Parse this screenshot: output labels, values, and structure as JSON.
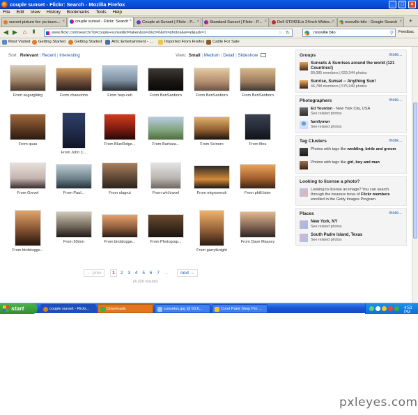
{
  "window": {
    "title": "couple sunset - Flickr: Search - Mozilla Firefox"
  },
  "menu": [
    "File",
    "Edit",
    "View",
    "History",
    "Bookmarks",
    "Tools",
    "Help"
  ],
  "tabs": [
    {
      "label": "sunset pixture for: ps tourn...",
      "color": "#e07a2d"
    },
    {
      "label": "couple sunset - Flickr: Search",
      "color": "#ff0084"
    },
    {
      "label": "Couple at Sunset | Flickr - P...",
      "color": "#ff0084"
    },
    {
      "label": "Standard Sunset | Flickr - P...",
      "color": "#ff0084"
    },
    {
      "label": "Dell ST2421Lb 24inch Wides...",
      "color": "#c22c2c"
    },
    {
      "label": "rossville bilo - Google Search",
      "color": "#3b73e0"
    }
  ],
  "address": {
    "url": "www.flickr.com/search/?q=couple+sunset&d=taken&ss=2&ct=0&mt=photos&w=all&adv=1"
  },
  "search": {
    "value": "rossville bilo"
  },
  "bookmarks": [
    "Most Visited",
    "Getting Started",
    "Getting Started",
    "Artic Entertainment - ...",
    "Imported From Firefox",
    "Cattle For Sale"
  ],
  "sort": {
    "label": "Sort:",
    "options": [
      "Relevant",
      "Recent",
      "Interesting"
    ]
  },
  "view": {
    "label": "View:",
    "options": [
      "Small",
      "Medium",
      "Detail",
      "Slideshow"
    ]
  },
  "photos": [
    {
      "caption": "From sugarglidrg",
      "colors": [
        "#d8cbb5",
        "#9e8366",
        "#4b3a2e"
      ]
    },
    {
      "caption": "From chasuinho",
      "colors": [
        "#d9a05a",
        "#6b4a38",
        "#2a1f1c"
      ]
    },
    {
      "caption": "From hwp-ceti",
      "colors": [
        "#b9c9d9",
        "#7d8fa1",
        "#2b2d33"
      ]
    },
    {
      "caption": "From BenSanborn",
      "colors": [
        "#3e3a36",
        "#191613",
        "#0a0908"
      ]
    },
    {
      "caption": "From BenSanborn",
      "colors": [
        "#e4c9a1",
        "#b48e6f",
        "#6a5447"
      ]
    },
    {
      "caption": "From BenSanborn",
      "colors": [
        "#d7b786",
        "#9b7c60",
        "#3e3832"
      ]
    },
    {
      "caption": "From quas",
      "colors": [
        "#a3683c",
        "#5a3822",
        "#2b1a10"
      ]
    },
    {
      "caption": "From John C...",
      "colors": [
        "#304066",
        "#1e2947",
        "#111425"
      ]
    },
    {
      "caption": "From BlueRidge...",
      "colors": [
        "#d23c1c",
        "#7a1a10",
        "#230806"
      ]
    },
    {
      "caption": "From Barbara...",
      "colors": [
        "#b7cbe0",
        "#7fa27a",
        "#4f6d3f"
      ]
    },
    {
      "caption": "From Scinern",
      "colors": [
        "#e0b36a",
        "#8a5a2f",
        "#1a140f"
      ]
    },
    {
      "caption": "From filnu",
      "colors": [
        "#3c4352",
        "#222733",
        "#101218"
      ]
    },
    {
      "caption": "From Grevel",
      "colors": [
        "#e8dfd8",
        "#c4b4b0",
        "#3a2c2e"
      ]
    },
    {
      "caption": "From Paul...",
      "colors": [
        "#bccbd3",
        "#6c8089",
        "#233139"
      ]
    },
    {
      "caption": "From olagrut",
      "colors": [
        "#a97e5c",
        "#5c4635",
        "#2d2219"
      ]
    },
    {
      "caption": "From whl.travel",
      "colors": [
        "#e3e4e6",
        "#b8b4b0",
        "#6f6660"
      ]
    },
    {
      "caption": "From mtgroveruk",
      "colors": [
        "#2f2a29",
        "#d48a37",
        "#1b1715"
      ]
    },
    {
      "caption": "From phill.lister",
      "colors": [
        "#e7a55b",
        "#a15d2c",
        "#3a2417"
      ]
    },
    {
      "caption": "From birdslogge...",
      "colors": [
        "#e3a66a",
        "#7a4a2c",
        "#231510"
      ]
    },
    {
      "caption": "From 50mm",
      "colors": [
        "#cfc7b6",
        "#6e6458",
        "#201c17"
      ]
    },
    {
      "caption": "From birdslogge...",
      "colors": [
        "#e8a36a",
        "#8a5a3d",
        "#2a1b14"
      ]
    },
    {
      "caption": "From Photograp...",
      "colors": [
        "#6a4b2f",
        "#3a2a1b",
        "#1a140d"
      ]
    },
    {
      "caption": "From garrytknight",
      "colors": [
        "#f2b36b",
        "#8b5a34",
        "#2b1b10"
      ]
    },
    {
      "caption": "From Dave Massey",
      "colors": [
        "#e1b88e",
        "#7d6152",
        "#2e2522"
      ]
    }
  ],
  "pager": {
    "prev": "← prev",
    "pages": [
      "1",
      "2",
      "3",
      "4",
      "5",
      "6",
      "7"
    ],
    "ellipsis": "...",
    "next": "next →",
    "results": "(4,320 results)"
  },
  "sidebar": {
    "groups": {
      "title": "Groups",
      "more": "more...",
      "items": [
        {
          "name": "Sunsets & Sunrises around the world (121 Countries!)",
          "meta": "89,085 members | 629,344 photos"
        },
        {
          "name": "Sunrise, Sunset -- Anything Sun!",
          "meta": "46,788 members | 575,949 photos"
        }
      ]
    },
    "photographers": {
      "title": "Photographers",
      "more": "more...",
      "items": [
        {
          "name": "Ed Yourdon",
          "loc": " - New York City, USA",
          "meta": "See related photos"
        },
        {
          "name": "familymwr",
          "loc": "",
          "meta": "See related photos"
        }
      ]
    },
    "tags": {
      "title": "Tag Clusters",
      "more": "more...",
      "items": [
        {
          "pre": "Photos with tags like ",
          "tags": "wedding, bride and groom"
        },
        {
          "pre": "Photos with tags like ",
          "tags": "girl, boy and man"
        }
      ]
    },
    "license": {
      "title": "Looking to license a photo?",
      "text1": "Looking to license an image? You can search through the treasure trove of ",
      "bold": "Flickr members",
      "text2": " enrolled in the Getty Images Program."
    },
    "places": {
      "title": "Places",
      "more": "more...",
      "items": [
        {
          "name": "New York, NY",
          "meta": "See related photos"
        },
        {
          "name": "South Padre Island, Texas",
          "meta": "See related photos"
        }
      ]
    }
  },
  "taskbar": {
    "start": "start",
    "buttons": [
      "couple sunset - Flickr...",
      "Downloads",
      "sunsetss.jpg @ 63.6...",
      "Corel Paint Shop Pro ..."
    ],
    "clock": "4:51 PM"
  },
  "watermark": "pxleyes.com"
}
